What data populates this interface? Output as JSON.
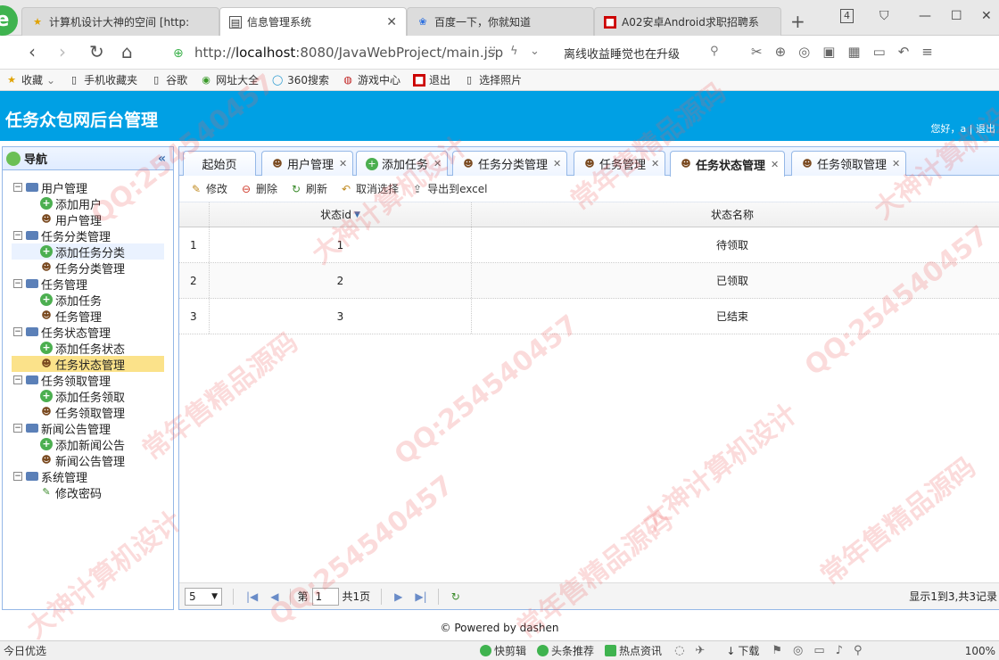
{
  "browser": {
    "tabs": [
      {
        "label": "计算机设计大神的空间 [http:",
        "icon": "star-icon"
      },
      {
        "label": "信息管理系统",
        "icon": "page-icon",
        "active": true
      },
      {
        "label": "百度一下，你就知道",
        "icon": "paw-icon"
      },
      {
        "label": "A02安卓Android求职招聘系",
        "icon": "red-square-icon"
      }
    ],
    "tab_count": "4",
    "url_prefix": "http://",
    "url_host": "localhost",
    "url_rest": ":8080/JavaWebProject/main.jsp",
    "promo_text": "离线收益睡觉也在升级",
    "bookmarks": [
      "收藏",
      "手机收藏夹",
      "谷歌",
      "网址大全",
      "360搜索",
      "游戏中心",
      "退出",
      "选择照片"
    ]
  },
  "app": {
    "title": "任务众包网后台管理",
    "greeting": "您好，a | 退出"
  },
  "nav": {
    "title": "导航",
    "tree": [
      {
        "label": "用户管理",
        "children": [
          "添加用户",
          "用户管理"
        ]
      },
      {
        "label": "任务分类管理",
        "children": [
          "添加任务分类",
          "任务分类管理"
        ]
      },
      {
        "label": "任务管理",
        "children": [
          "添加任务",
          "任务管理"
        ]
      },
      {
        "label": "任务状态管理",
        "children": [
          "添加任务状态",
          "任务状态管理"
        ]
      },
      {
        "label": "任务领取管理",
        "children": [
          "添加任务领取",
          "任务领取管理"
        ]
      },
      {
        "label": "新闻公告管理",
        "children": [
          "添加新闻公告",
          "新闻公告管理"
        ]
      },
      {
        "label": "系统管理",
        "children": [
          "修改密码"
        ]
      }
    ]
  },
  "content_tabs": [
    {
      "label": "起始页",
      "closable": false
    },
    {
      "label": "用户管理",
      "closable": true
    },
    {
      "label": "添加任务",
      "closable": true
    },
    {
      "label": "任务分类管理",
      "closable": true
    },
    {
      "label": "任务管理",
      "closable": true
    },
    {
      "label": "任务状态管理",
      "closable": true,
      "active": true
    },
    {
      "label": "任务领取管理",
      "closable": true
    }
  ],
  "toolbar": {
    "edit": "修改",
    "delete": "删除",
    "refresh": "刷新",
    "unselect": "取消选择",
    "export": "导出到excel"
  },
  "table": {
    "columns": [
      "状态id",
      "状态名称"
    ],
    "rows": [
      {
        "num": "1",
        "id": "1",
        "name": "待领取"
      },
      {
        "num": "2",
        "id": "2",
        "name": "已领取"
      },
      {
        "num": "3",
        "id": "3",
        "name": "已结束"
      }
    ]
  },
  "pager": {
    "page_size": "5",
    "page_prefix": "第",
    "page_value": "1",
    "page_suffix": "共1页",
    "info": "显示1到3,共3记录"
  },
  "footer": "© Powered by dashen",
  "statusbar": {
    "left": "今日优选",
    "items": [
      "快剪辑",
      "头条推荐",
      "热点资讯"
    ],
    "download": "下载",
    "zoom": "100%"
  },
  "watermarks": [
    "QQ:254540457",
    "大神计算机设计",
    "常年售精品源码"
  ],
  "colors": {
    "header": "#00a0e4",
    "selected": "#fbe28a",
    "border": "#95b8e7"
  }
}
